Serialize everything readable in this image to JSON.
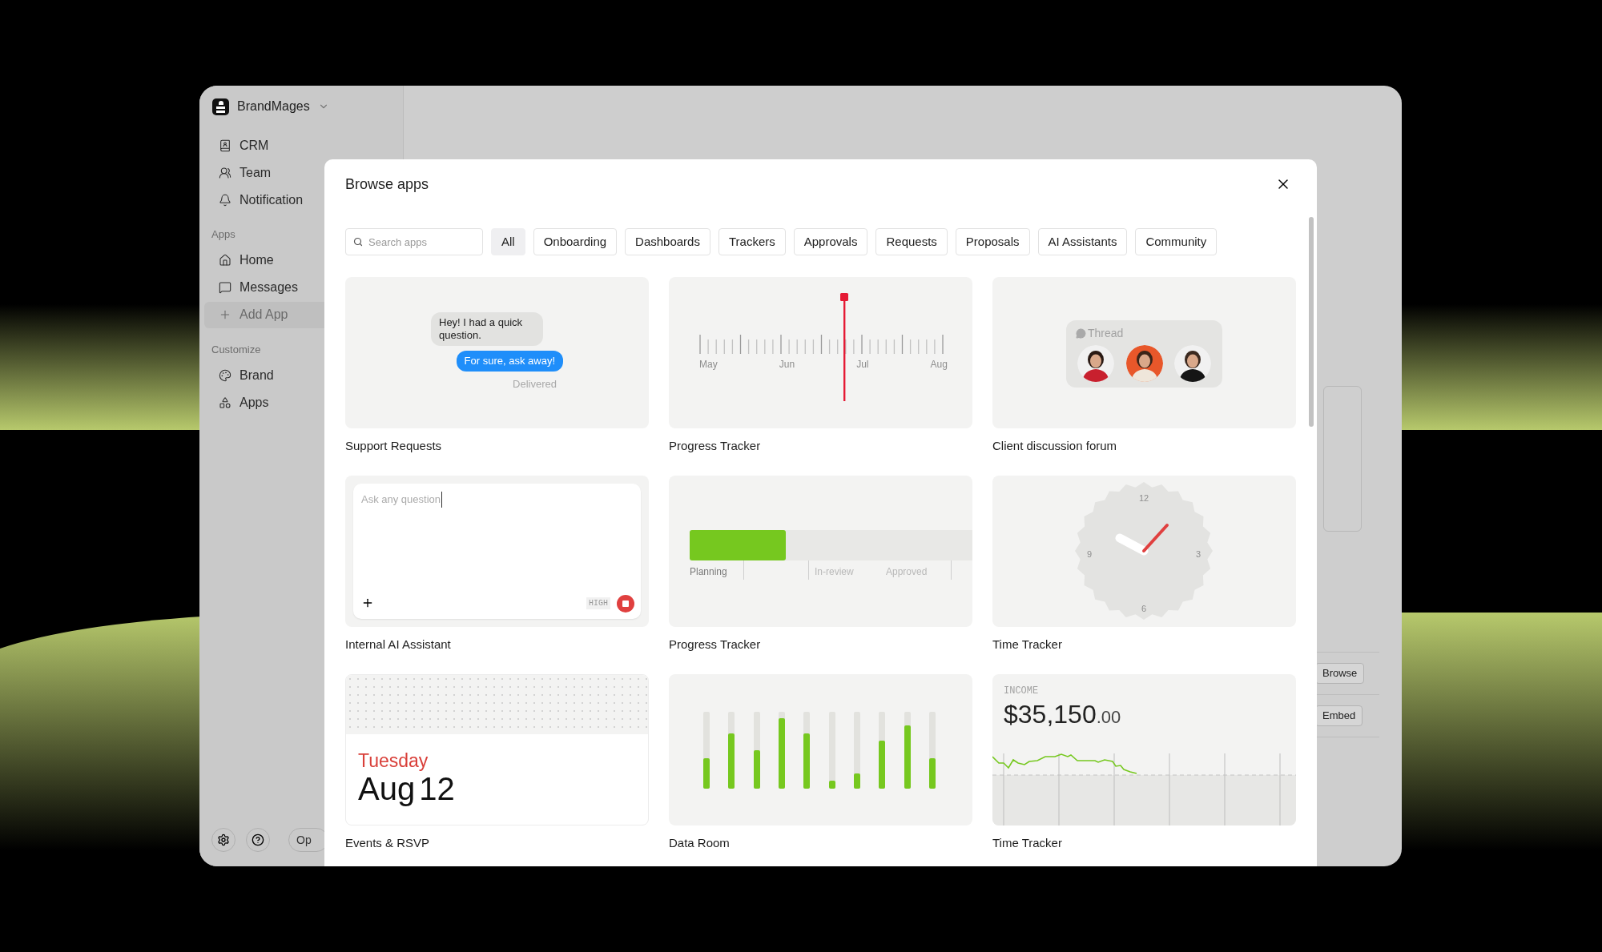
{
  "sidebar": {
    "workspace": "BrandMages",
    "items": [
      {
        "label": "CRM",
        "selected": false
      },
      {
        "label": "Team",
        "selected": false
      },
      {
        "label": "Notification",
        "selected": false
      }
    ],
    "sections": [
      {
        "title": "Apps",
        "items": [
          {
            "label": "Home",
            "selected": false
          },
          {
            "label": "Messages",
            "selected": false
          },
          {
            "label": "Add App",
            "selected": true
          }
        ]
      },
      {
        "title": "Customize",
        "items": [
          {
            "label": "Brand",
            "selected": false
          },
          {
            "label": "Apps",
            "selected": false
          }
        ]
      }
    ],
    "footer_button": "Op"
  },
  "main": {
    "buttons": [
      "Browse",
      "Embed"
    ]
  },
  "modal": {
    "title": "Browse apps",
    "search": {
      "placeholder": "Search apps"
    },
    "filters": [
      {
        "label": "All",
        "selected": true
      },
      {
        "label": "Onboarding",
        "selected": false
      },
      {
        "label": "Dashboards",
        "selected": false
      },
      {
        "label": "Trackers",
        "selected": false
      },
      {
        "label": "Approvals",
        "selected": false
      },
      {
        "label": "Requests",
        "selected": false
      },
      {
        "label": "Proposals",
        "selected": false
      },
      {
        "label": "AI Assistants",
        "selected": false
      },
      {
        "label": "Community",
        "selected": false
      }
    ],
    "apps": [
      {
        "name": "Support Requests",
        "kind": "chat",
        "messages": [
          {
            "text": "Hey! I had a quick question.",
            "kind": "received"
          },
          {
            "text": "For sure, ask away!",
            "kind": "sent"
          }
        ],
        "status": "Delivered"
      },
      {
        "name": "Progress Tracker",
        "kind": "timeline",
        "months": [
          "May",
          "Jun",
          "Jul",
          "Aug"
        ]
      },
      {
        "name": "Client discussion forum",
        "kind": "thread",
        "label": "Thread"
      },
      {
        "name": "Internal AI Assistant",
        "kind": "prompt",
        "placeholder": "Ask any question",
        "badge": "HIGH"
      },
      {
        "name": "Progress Tracker",
        "kind": "stages",
        "level": 0.34,
        "stages": [
          {
            "label": "Planning",
            "active": true
          },
          {
            "label": "In-review",
            "active": false
          },
          {
            "label": "Approved",
            "active": false
          }
        ]
      },
      {
        "name": "Time Tracker",
        "kind": "clock",
        "numerals": [
          "12",
          "3",
          "6",
          "9"
        ]
      },
      {
        "name": "Events & RSVP",
        "kind": "date",
        "weekday": "Tuesday",
        "month": "Aug",
        "day": "12"
      },
      {
        "name": "Data Room",
        "kind": "bars",
        "bars": [
          {
            "level": 0.4
          },
          {
            "level": 0.72
          },
          {
            "level": 0.5
          },
          {
            "level": 0.92
          },
          {
            "level": 0.72
          },
          {
            "level": 0.1
          },
          {
            "level": 0.2
          },
          {
            "level": 0.62
          },
          {
            "level": 0.82
          },
          {
            "level": 0.4
          }
        ]
      },
      {
        "name": "Time Tracker",
        "kind": "income",
        "label": "INCOME",
        "amount": "$35,150",
        "cents": ".00"
      }
    ]
  }
}
